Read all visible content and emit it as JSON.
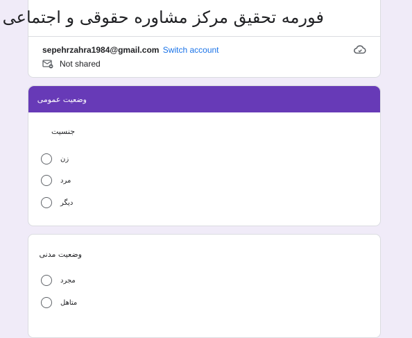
{
  "header": {
    "title": "فورمه تحقیق مرکز مشاوره حقوقی و اجتماعی آوا",
    "email": "sepehrzahra1984@gmail.com",
    "switch_account": "Switch account",
    "shared_status": "Not shared",
    "cloud_icon": "cloud-icon",
    "not_shared_icon": "not-shared-icon"
  },
  "section": {
    "title": "وضعیت عمومی",
    "color": "#673ab7"
  },
  "questions": [
    {
      "title": "جنسیت",
      "options": [
        "زن",
        "مرد",
        "دیگر"
      ]
    },
    {
      "title": "وضعیت مدنی",
      "options": [
        "مجرد",
        "متاهل"
      ]
    }
  ],
  "colors": {
    "background": "#f0ebf8",
    "accent": "#673ab7",
    "link": "#1a73e8"
  }
}
